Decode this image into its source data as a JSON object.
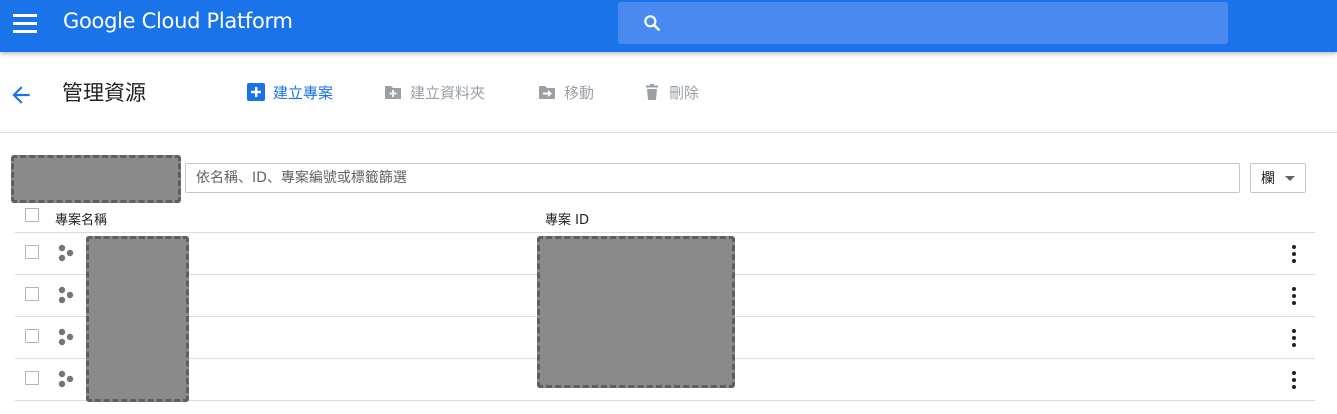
{
  "header": {
    "brand": "Google Cloud Platform",
    "search_placeholder": "",
    "menu_icon": "hamburger-menu-icon",
    "search_icon": "search-icon",
    "color": "#1a73e8"
  },
  "toolbar": {
    "back_icon": "arrow-back-icon",
    "title": "管理資源",
    "create_project": "建立專案",
    "create_folder": "建立資料夾",
    "move": "移動",
    "delete": "刪除",
    "accent_color": "#1a73e8",
    "disabled_color": "#9aa0a6"
  },
  "filter": {
    "placeholder": "依名稱、ID、專案編號或標籤篩選",
    "value": "",
    "columns_label": "欄"
  },
  "table": {
    "headers": {
      "name": "專案名稱",
      "id": "專案 ID"
    },
    "rows": [
      {
        "name": "",
        "id": ""
      },
      {
        "name": "",
        "id": ""
      },
      {
        "name": "",
        "id": ""
      },
      {
        "name": "",
        "id": ""
      }
    ]
  }
}
